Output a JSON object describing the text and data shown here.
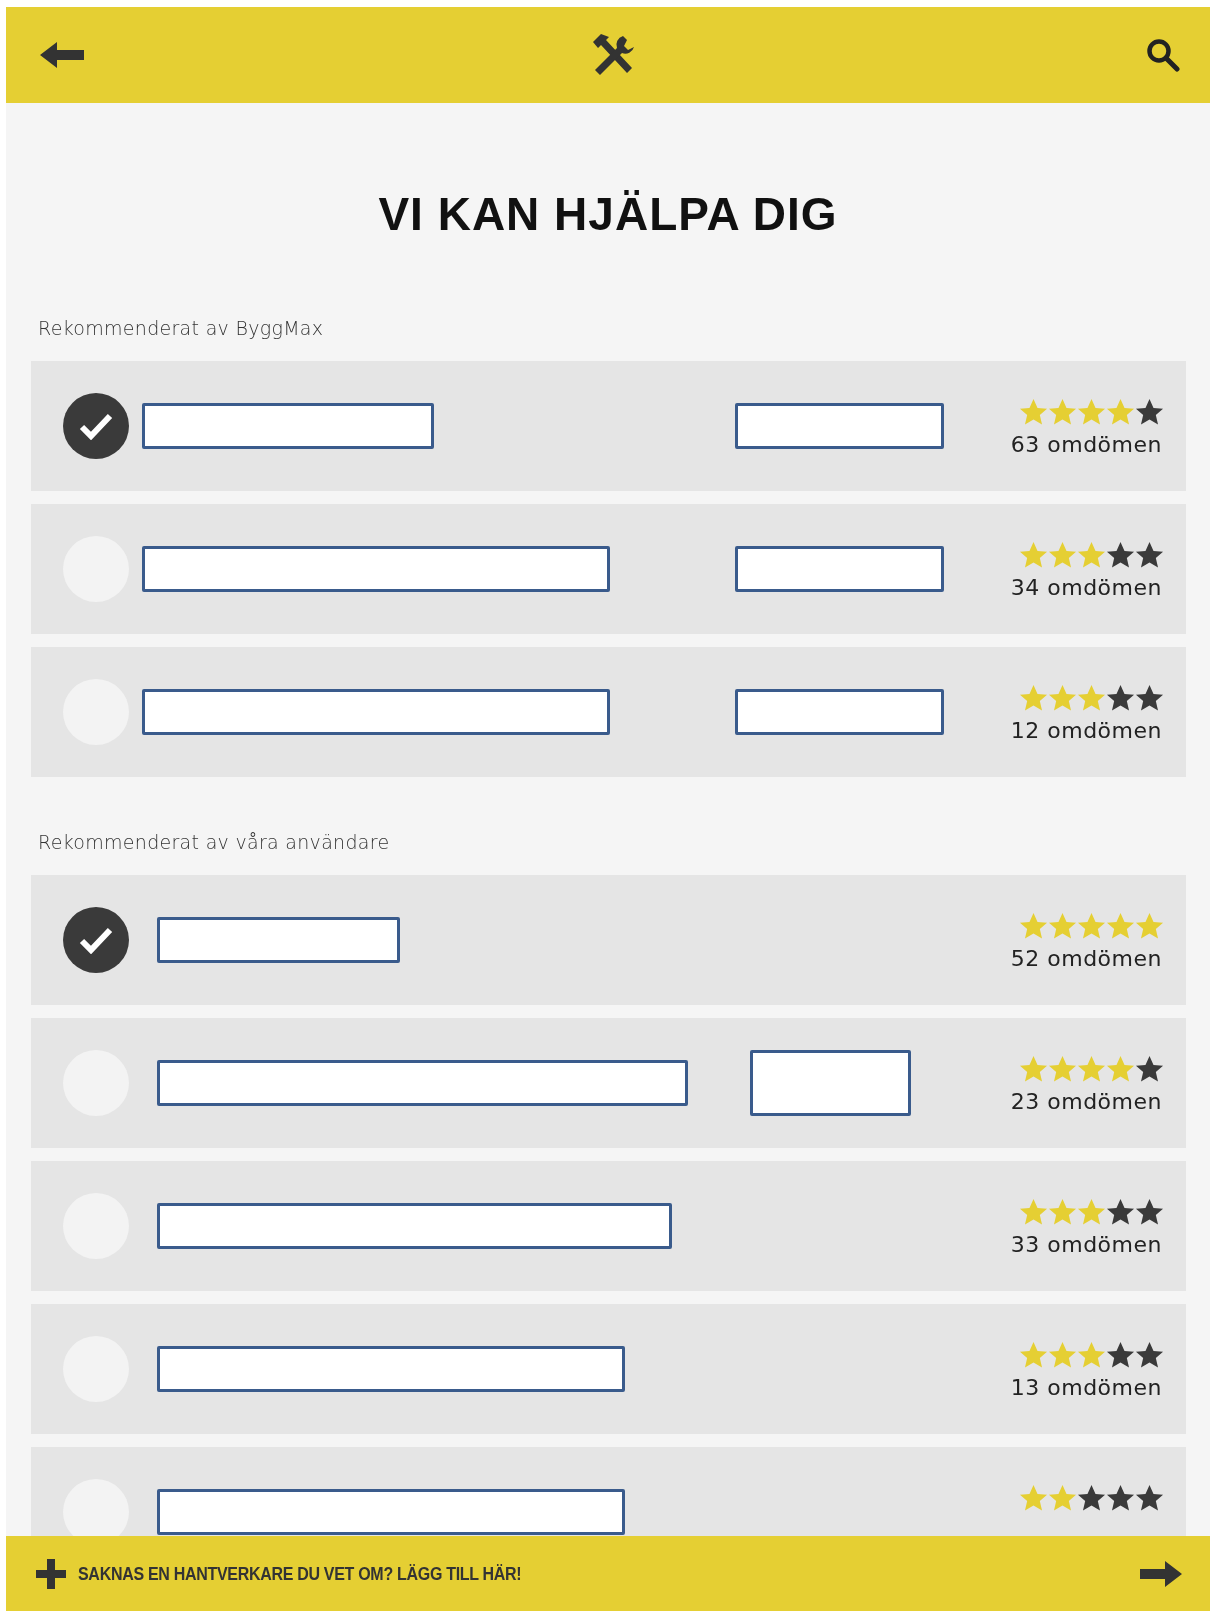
{
  "header": {
    "kind": "app-bar"
  },
  "title": "VI KAN HJÄLPA DIG",
  "sections": [
    {
      "label": "Rekommenderat av ByggMax",
      "rows": [
        {
          "selected": true,
          "stars": 4,
          "reviews": "63 omdömen",
          "redacted": [
            {
              "kind": "name"
            },
            {
              "kind": "detail"
            }
          ]
        },
        {
          "selected": false,
          "stars": 3,
          "reviews": "34 omdömen",
          "redacted": [
            {
              "kind": "name"
            },
            {
              "kind": "detail"
            }
          ]
        },
        {
          "selected": false,
          "stars": 3,
          "reviews": "12 omdömen",
          "redacted": [
            {
              "kind": "name"
            },
            {
              "kind": "detail"
            }
          ]
        }
      ]
    },
    {
      "label": "Rekommenderat av våra användare",
      "rows": [
        {
          "selected": true,
          "stars": 5,
          "reviews": "52 omdömen",
          "redacted": [
            {
              "kind": "name"
            }
          ]
        },
        {
          "selected": false,
          "stars": 4,
          "reviews": "23 omdömen",
          "redacted": [
            {
              "kind": "name"
            },
            {
              "kind": "detail"
            }
          ]
        },
        {
          "selected": false,
          "stars": 3,
          "reviews": "33 omdömen",
          "redacted": [
            {
              "kind": "name"
            }
          ]
        },
        {
          "selected": false,
          "stars": 3,
          "reviews": "13 omdömen",
          "redacted": [
            {
              "kind": "name"
            }
          ]
        },
        {
          "selected": false,
          "stars": 2,
          "redacted": [
            {
              "kind": "name"
            }
          ]
        }
      ]
    }
  ],
  "footer": {
    "text": "SAKNAS EN HANTVERKARE DU VET OM? LÄGG TILL HÄR!"
  }
}
